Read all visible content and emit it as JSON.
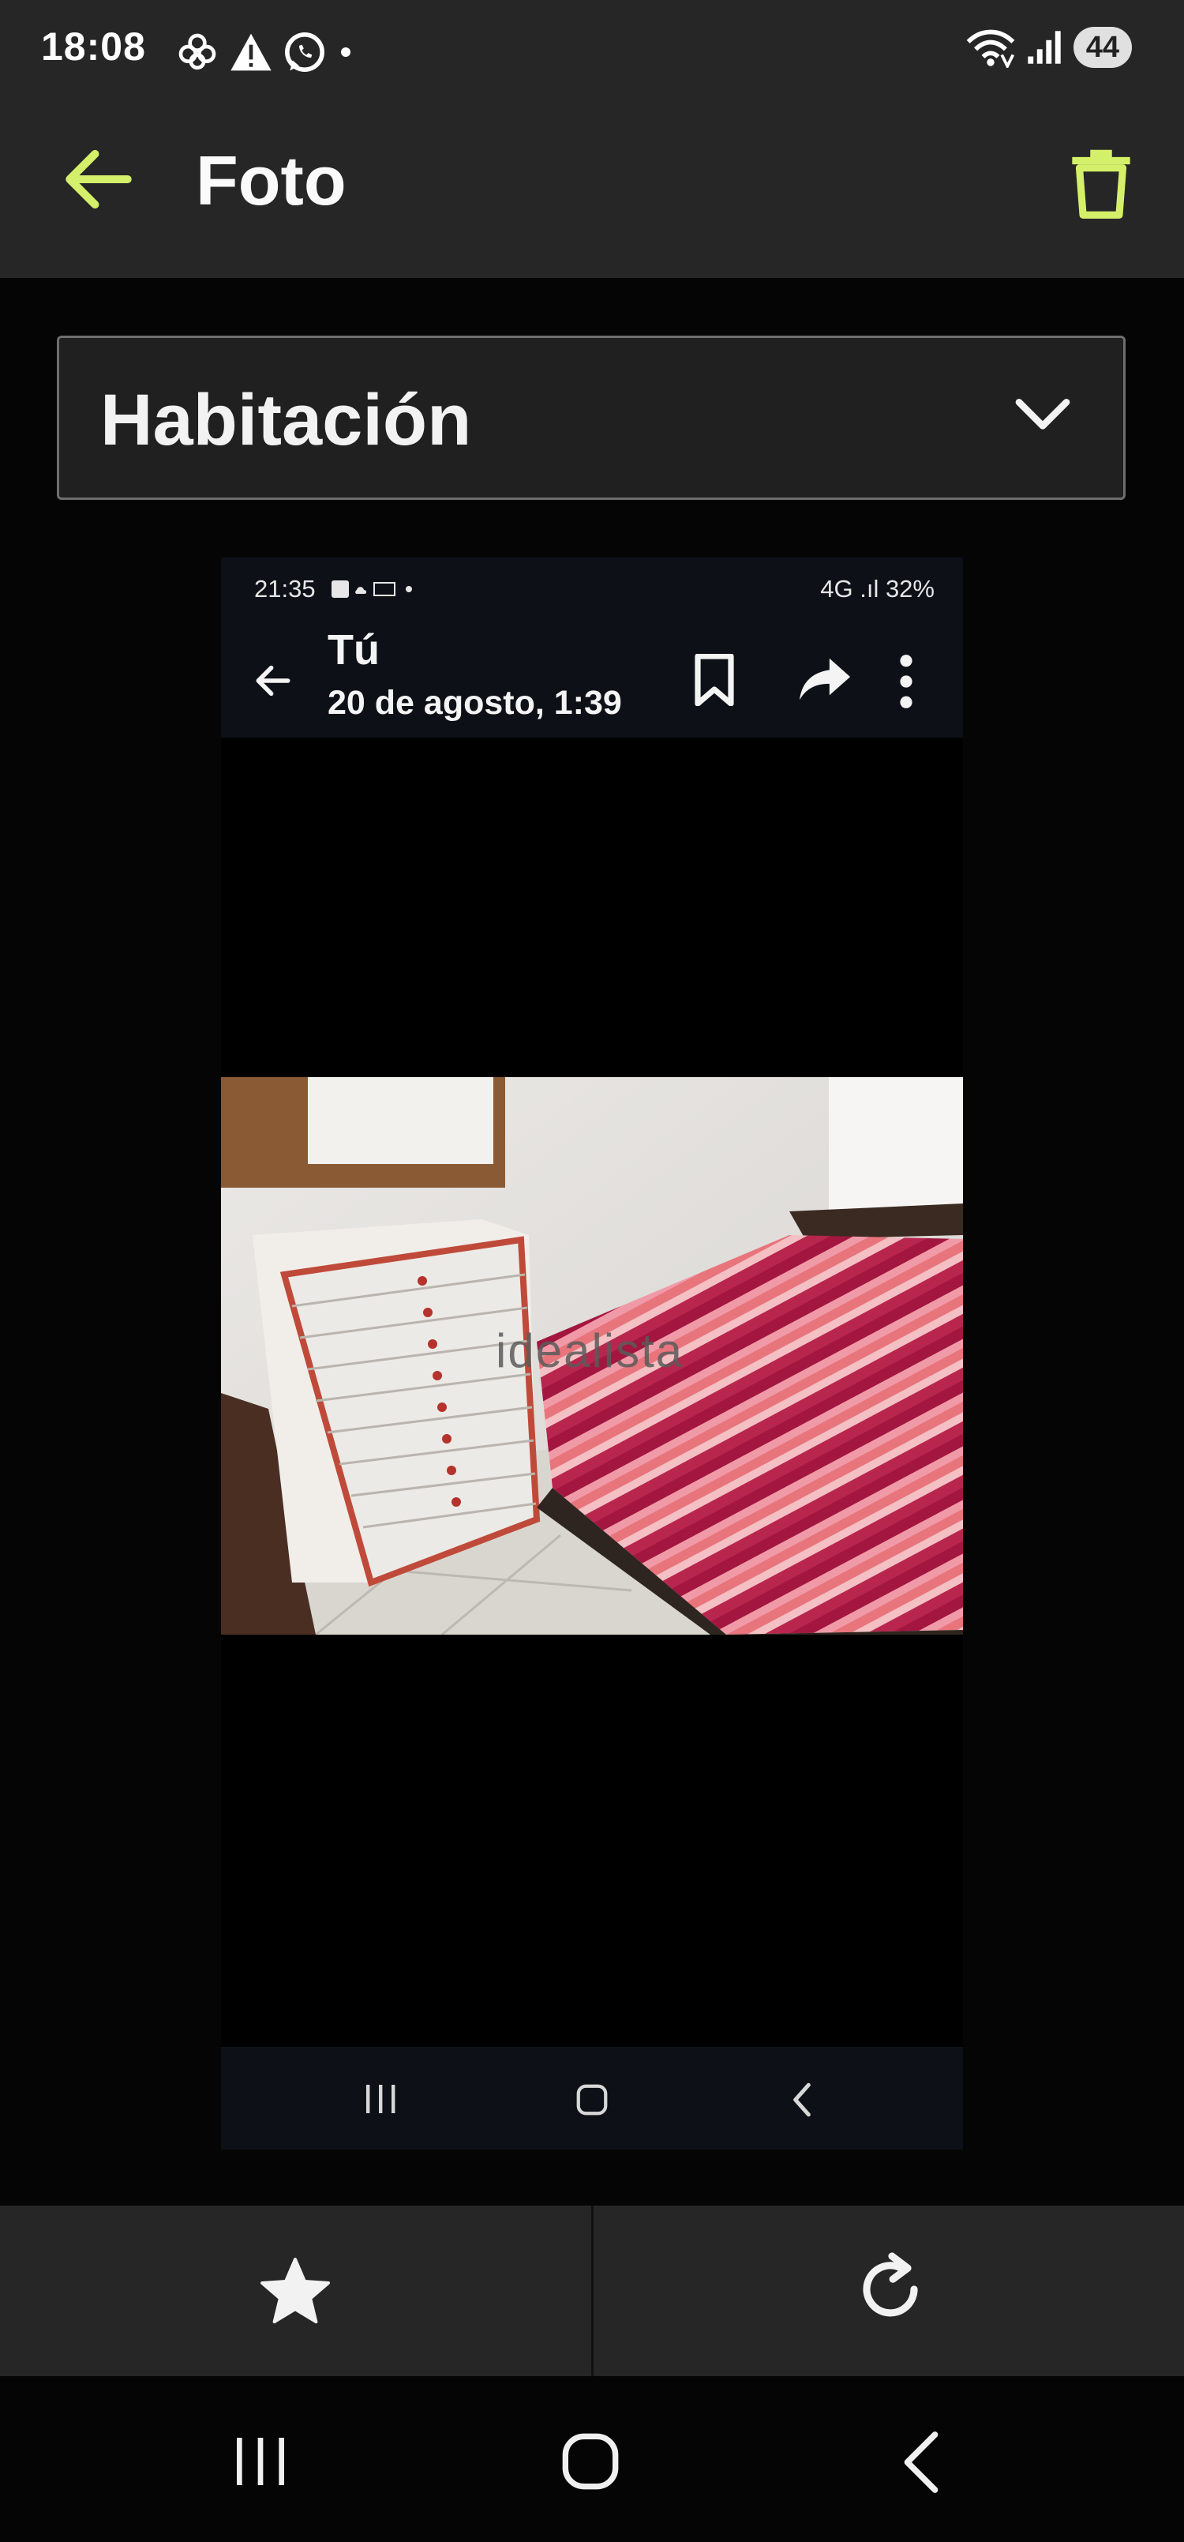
{
  "status_bar": {
    "time": "18:08",
    "battery": "44",
    "icons": [
      "flower-notification-icon",
      "warning-icon",
      "whatsapp-icon",
      "dot-icon",
      "wifi-icon",
      "signal-icon"
    ]
  },
  "app_bar": {
    "title": "Foto",
    "accent_color": "#d4f06a"
  },
  "category_select": {
    "value": "Habitación"
  },
  "inner_screenshot": {
    "status_time": "21:35",
    "status_right": "4G .ıl 32%",
    "sender": "Tú",
    "date": "20 de agosto, 1:39",
    "watermark": "idealista"
  },
  "actions": {
    "icons": [
      "star-icon",
      "rotate-icon"
    ]
  },
  "colors": {
    "bar_background": "#262626",
    "page_background": "#050505",
    "inner_bar_background": "#0d1117"
  }
}
